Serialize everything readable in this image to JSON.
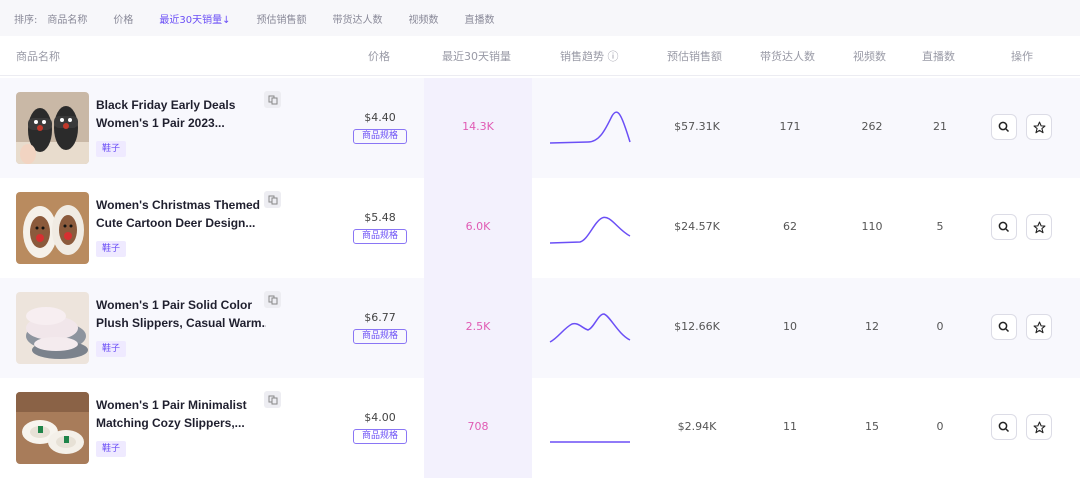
{
  "sort_bar": {
    "label": "排序:",
    "options": [
      "商品名称",
      "价格",
      "最近30天销量↓",
      "预估销售额",
      "带货达人数",
      "视频数",
      "直播数"
    ]
  },
  "columns": {
    "product": "商品名称",
    "price": "价格",
    "sales": "最近30天销量",
    "trend": "销售趋势 ⓘ",
    "revenue": "预估销售额",
    "creators": "带货达人数",
    "videos": "视频数",
    "lives": "直播数",
    "actions": "操作"
  },
  "colors": {
    "accent": "#6b4ff6",
    "sales_text": "#e05bb4",
    "tag_bg": "#efeaff"
  },
  "rows": [
    {
      "title_line1": "Black Friday Early Deals",
      "title_line2": "Women's 1 Pair 2023...",
      "tag": "鞋子",
      "price": "$4.40",
      "spec": "商品规格",
      "sales": "14.3K",
      "revenue": "$57.31K",
      "creators": "171",
      "videos": "262",
      "lives": "21"
    },
    {
      "title_line1": "Women's Christmas Themed",
      "title_line2": "Cute Cartoon Deer Design...",
      "tag": "鞋子",
      "price": "$5.48",
      "spec": "商品规格",
      "sales": "6.0K",
      "revenue": "$24.57K",
      "creators": "62",
      "videos": "110",
      "lives": "5"
    },
    {
      "title_line1": "Women's 1 Pair Solid Color",
      "title_line2": "Plush Slippers, Casual Warm...",
      "tag": "鞋子",
      "price": "$6.77",
      "spec": "商品规格",
      "sales": "2.5K",
      "revenue": "$12.66K",
      "creators": "10",
      "videos": "12",
      "lives": "0"
    },
    {
      "title_line1": "Women's 1 Pair Minimalist",
      "title_line2": "Matching Cozy Slippers,...",
      "tag": "鞋子",
      "price": "$4.00",
      "spec": "商品规格",
      "sales": "708",
      "revenue": "$2.94K",
      "creators": "11",
      "videos": "15",
      "lives": "0"
    }
  ],
  "icons": [
    "copy-icon",
    "search-icon",
    "star-icon"
  ]
}
